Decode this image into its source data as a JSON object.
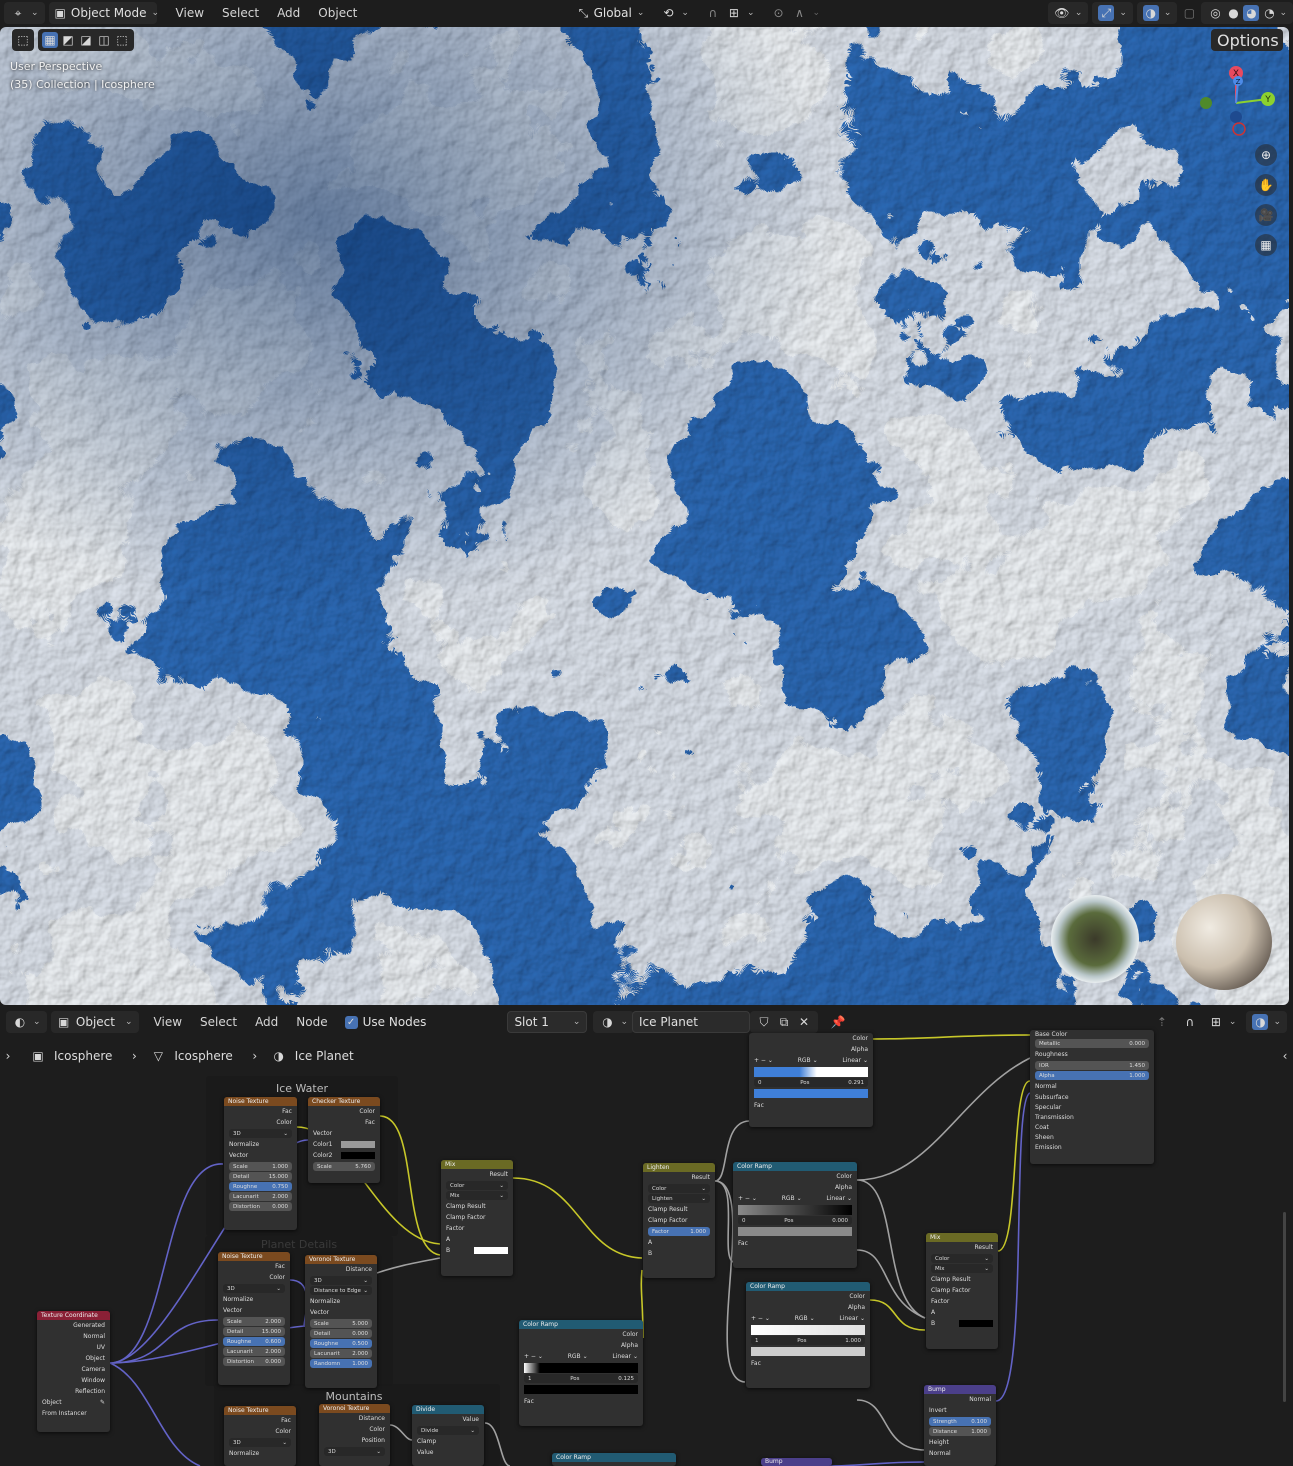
{
  "top_header": {
    "mode": "Object Mode",
    "menus": [
      "View",
      "Select",
      "Add",
      "Object"
    ],
    "orientation": "Global",
    "options": "Options"
  },
  "viewport": {
    "perspective": "User Perspective",
    "collection": "(35) Collection | Icosphere",
    "gizmo": {
      "x": "X",
      "y": "Y",
      "z": "Z"
    }
  },
  "node_header": {
    "editor_type": "Object",
    "menus": [
      "View",
      "Select",
      "Add",
      "Node"
    ],
    "use_nodes": "Use Nodes",
    "slot": "Slot 1",
    "material": "Ice Planet"
  },
  "breadcrumb": [
    "Icosphere",
    "Icosphere",
    "Ice Planet"
  ],
  "frames": {
    "ice_water": "Ice Water",
    "planet_details": "Planet Details",
    "mountains": "Mountains"
  },
  "nodes": {
    "noise1": {
      "title": "Noise Texture",
      "fac": "Fac",
      "color": "Color",
      "dim": "3D",
      "normalize": "Normalize",
      "vector": "Vector",
      "scale": "Scale",
      "scale_v": "1.000",
      "detail": "Detail",
      "detail_v": "15.000",
      "rough": "Roughne",
      "rough_v": "0.750",
      "lac": "Lacunarit",
      "lac_v": "2.000",
      "dist": "Distortion",
      "dist_v": "0.000"
    },
    "checker": {
      "title": "Checker Texture",
      "color": "Color",
      "fac": "Fac",
      "vector": "Vector",
      "c1": "Color1",
      "c2": "Color2",
      "scale": "Scale",
      "scale_v": "5.760"
    },
    "mix1": {
      "title": "Mix",
      "result": "Result",
      "type": "Color",
      "blend": "Mix",
      "clamp_r": "Clamp Result",
      "clamp_f": "Clamp Factor",
      "factor": "Factor",
      "a": "A",
      "b": "B"
    },
    "lighten": {
      "title": "Lighten",
      "result": "Result",
      "type": "Color",
      "blend": "Lighten",
      "clamp_r": "Clamp Result",
      "clamp_f": "Clamp Factor",
      "factor": "Factor",
      "factor_v": "1.000",
      "a": "A",
      "b": "B"
    },
    "ramp_top": {
      "color": "Color",
      "alpha": "Alpha",
      "rgb": "RGB",
      "interp": "Linear",
      "idx": "0",
      "pos": "Pos",
      "pos_v": "0.291",
      "fac": "Fac"
    },
    "bsdf": {
      "base": "Base Color",
      "metallic": "Metallic",
      "metallic_v": "0.000",
      "roughness": "Roughness",
      "ior": "IOR",
      "ior_v": "1.450",
      "alpha": "Alpha",
      "alpha_v": "1.000",
      "normal": "Normal",
      "subsurface": "Subsurface",
      "specular": "Specular",
      "transmission": "Transmission",
      "coat": "Coat",
      "sheen": "Sheen",
      "emission": "Emission"
    },
    "ramp1": {
      "title": "Color Ramp",
      "color": "Color",
      "alpha": "Alpha",
      "rgb": "RGB",
      "interp": "Linear",
      "idx": "0",
      "pos": "Pos",
      "pos_v": "0.000",
      "fac": "Fac"
    },
    "noise2": {
      "title": "Noise Texture",
      "fac": "Fac",
      "color": "Color",
      "dim": "3D",
      "normalize": "Normalize",
      "vector": "Vector",
      "scale": "Scale",
      "scale_v": "2.000",
      "detail": "Detail",
      "detail_v": "15.000",
      "rough": "Roughne",
      "rough_v": "0.600",
      "lac": "Lacunarit",
      "lac_v": "2.000",
      "dist": "Distortion",
      "dist_v": "0.000"
    },
    "voronoi1": {
      "title": "Voronoi Texture",
      "distance": "Distance",
      "dim": "3D",
      "feature": "Distance to Edge",
      "normalize": "Normalize",
      "vector": "Vector",
      "scale": "Scale",
      "scale_v": "5.000",
      "detail": "Detail",
      "detail_v": "0.000",
      "rough": "Roughne",
      "rough_v": "0.500",
      "lac": "Lacunarit",
      "lac_v": "2.000",
      "rand": "Randomn",
      "rand_v": "1.000"
    },
    "texcoord": {
      "title": "Texture Coordinate",
      "generated": "Generated",
      "normal": "Normal",
      "uv": "UV",
      "object": "Object",
      "camera": "Camera",
      "window": "Window",
      "reflection": "Reflection",
      "obj_field": "Object",
      "from_instancer": "From Instancer"
    },
    "ramp2": {
      "title": "Color Ramp",
      "color": "Color",
      "alpha": "Alpha",
      "rgb": "RGB",
      "interp": "Linear",
      "idx": "1",
      "pos": "Pos",
      "pos_v": "0.125",
      "fac": "Fac"
    },
    "ramp3": {
      "title": "Color Ramp",
      "color": "Color",
      "alpha": "Alpha",
      "rgb": "RGB",
      "interp": "Linear",
      "idx": "1",
      "pos": "Pos",
      "pos_v": "1.000",
      "fac": "Fac"
    },
    "mix2": {
      "title": "Mix",
      "result": "Result",
      "type": "Color",
      "blend": "Mix",
      "clamp_r": "Clamp Result",
      "clamp_f": "Clamp Factor",
      "factor": "Factor",
      "a": "A",
      "b": "B"
    },
    "bump1": {
      "title": "Bump",
      "normal": "Normal",
      "invert": "Invert",
      "strength": "Strength",
      "strength_v": "0.100",
      "distance": "Distance",
      "distance_v": "1.000",
      "height": "Height",
      "normal_in": "Normal"
    },
    "noise3": {
      "title": "Noise Texture",
      "fac": "Fac",
      "color": "Color",
      "dim": "3D",
      "normalize": "Normalize"
    },
    "voronoi2": {
      "title": "Voronoi Texture",
      "distance": "Distance",
      "color": "Color",
      "position": "Position",
      "dim": "3D"
    },
    "divide": {
      "title": "Divide",
      "value": "Value",
      "op": "Divide",
      "clamp": "Clamp",
      "value_in": "Value"
    },
    "ramp4": {
      "title": "Color Ramp"
    },
    "bump2": {
      "title": "Bump"
    }
  },
  "colors": {
    "accent": "#4772b3",
    "sock_yellow": "#c7c729",
    "sock_purple": "#6363c7",
    "sock_grey": "#a1a1a1"
  }
}
